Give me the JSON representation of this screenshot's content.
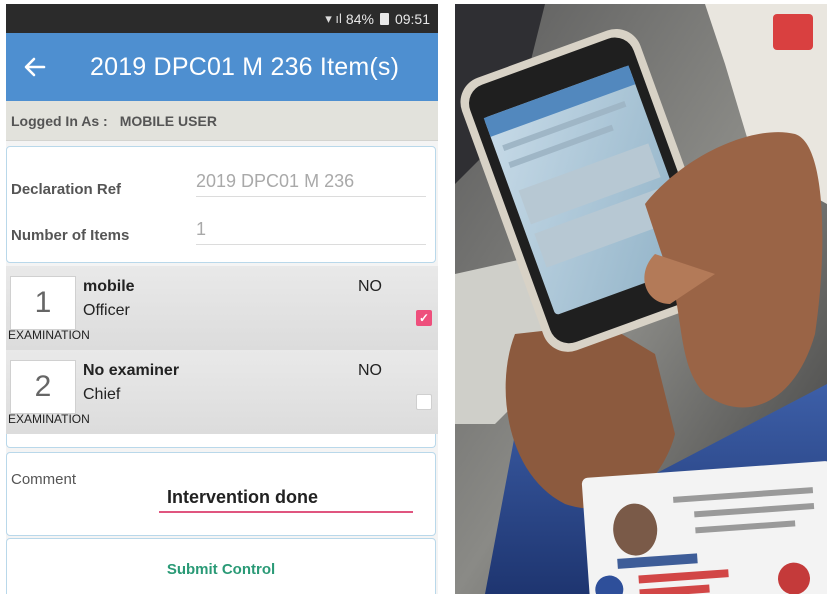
{
  "status_bar": {
    "signal": "!↗ ▐",
    "battery": "84%",
    "time": "09:51"
  },
  "app_bar": {
    "back_icon": "arrow-left-icon",
    "title": "2019 DPC01 M 236 Item(s)"
  },
  "logged_in": {
    "label": "Logged In As :",
    "user": "MOBILE USER"
  },
  "declaration": {
    "ref_label": "Declaration Ref",
    "ref_value": "2019 DPC01 M 236",
    "items_label": "Number of Items",
    "items_value": "1"
  },
  "items": [
    {
      "number": "1",
      "name": "mobile",
      "role": "Officer",
      "type": "EXAMINATION",
      "status": "NO",
      "checked": true
    },
    {
      "number": "2",
      "name": "No examiner",
      "role": "Chief",
      "type": "EXAMINATION",
      "status": "NO",
      "checked": false
    }
  ],
  "comment": {
    "label": "Comment",
    "value": "Intervention done"
  },
  "submit": {
    "label": "Submit Control"
  },
  "colors": {
    "app_bar": "#4e8fd0",
    "accent_pink": "#ee4f7c",
    "submit_green": "#2a9a76"
  }
}
